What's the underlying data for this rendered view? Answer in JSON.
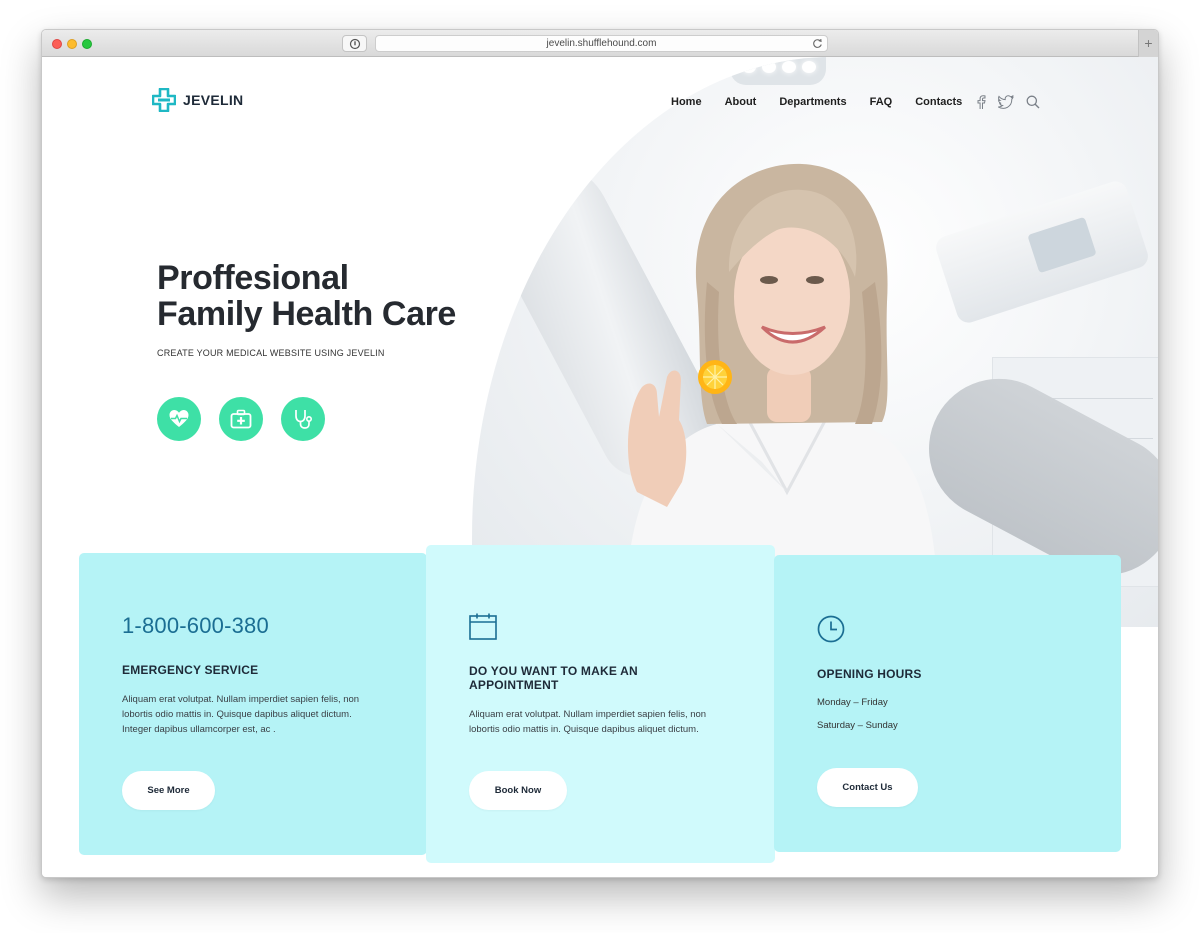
{
  "browser": {
    "url": "jevelin.shufflehound.com",
    "new_tab": "+"
  },
  "header": {
    "brand": "JEVELIN",
    "nav": [
      "Home",
      "About",
      "Departments",
      "FAQ",
      "Contacts"
    ],
    "icons": [
      "facebook-icon",
      "twitter-icon",
      "search-icon"
    ]
  },
  "hero": {
    "title_line1": "Proffesional",
    "title_line2": "Family Health Care",
    "subtitle": "CREATE YOUR MEDICAL WEBSITE USING JEVELIN",
    "feature_icons": [
      "heart-pulse-icon",
      "first-aid-kit-icon",
      "stethoscope-icon"
    ]
  },
  "cards": {
    "emergency": {
      "phone": "1-800-600-380",
      "title": "EMERGENCY SERVICE",
      "text_line1": "Aliquam erat volutpat. Nullam imperdiet sapien felis, non",
      "text_line2": "lobortis odio mattis in. Quisque dapibus aliquet dictum.",
      "text_line3": "Integer dapibus ullamcorper est, ac .",
      "button": "See More"
    },
    "appointment": {
      "title_line1": "DO YOU WANT TO MAKE AN",
      "title_line2": "APPOINTMENT",
      "text_line1": "Aliquam erat volutpat. Nullam imperdiet sapien felis, non",
      "text_line2": "lobortis odio mattis in. Quisque dapibus aliquet dictum.",
      "button": "Book Now"
    },
    "hours": {
      "title": "OPENING HOURS",
      "weekdays": "Monday – Friday",
      "weekend": "Saturday – Sunday",
      "button": "Contact Us"
    }
  },
  "colors": {
    "accent_green": "#3ee0a6",
    "card_cyan": "#b5f3f6",
    "card_cyan_light": "#d0fafc",
    "phone_blue": "#1b6e93",
    "logo_teal": "#1fb8c4"
  }
}
